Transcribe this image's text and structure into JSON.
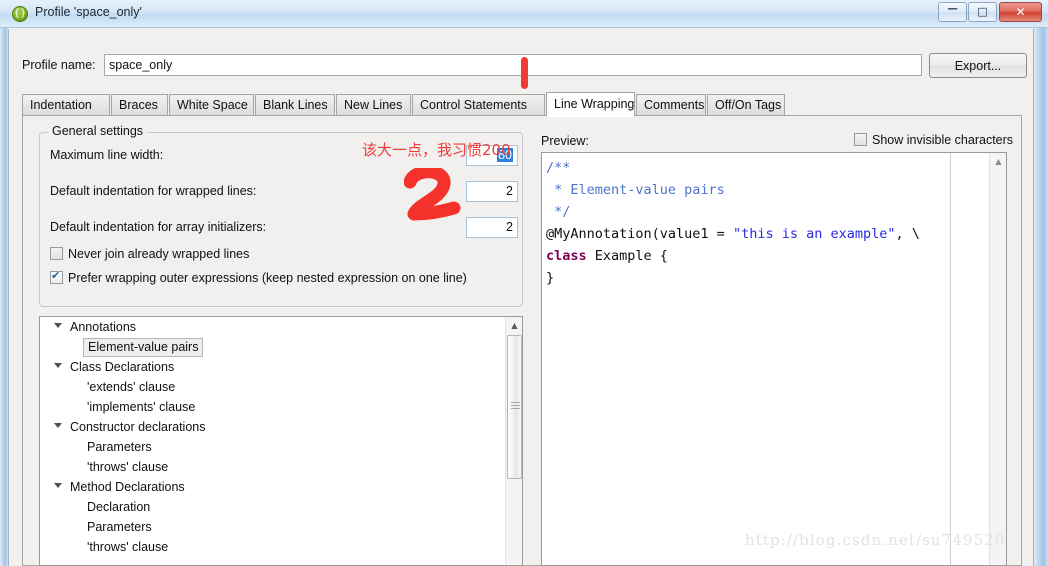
{
  "window": {
    "title": "Profile 'space_only'",
    "icon": "braces-icon",
    "minimize_label": "─",
    "maximize_label": "□",
    "close_label": "✕"
  },
  "profile": {
    "name_label": "Profile name:",
    "name_value": "space_only",
    "export_label": "Export..."
  },
  "tabs": [
    {
      "label": "Indentation",
      "selected": false
    },
    {
      "label": "Braces",
      "selected": false
    },
    {
      "label": "White Space",
      "selected": false
    },
    {
      "label": "Blank Lines",
      "selected": false
    },
    {
      "label": "New Lines",
      "selected": false
    },
    {
      "label": "Control Statements",
      "selected": false
    },
    {
      "label": "Line Wrapping",
      "selected": true
    },
    {
      "label": "Comments",
      "selected": false
    },
    {
      "label": "Off/On Tags",
      "selected": false
    }
  ],
  "general_settings": {
    "group_title": "General settings",
    "max_line_width_label": "Maximum line width:",
    "max_line_width_value": "80",
    "wrapped_indent_label": "Default indentation for wrapped lines:",
    "wrapped_indent_value": "2",
    "array_indent_label": "Default indentation for array initializers:",
    "array_indent_value": "2",
    "never_join_label": "Never join already wrapped lines",
    "never_join_checked": false,
    "prefer_wrapping_label": "Prefer wrapping outer expressions (keep nested expression on one line)",
    "prefer_wrapping_checked": true
  },
  "tree": {
    "items": [
      {
        "label": "Annotations",
        "level": 0,
        "expandable": true,
        "selected": false
      },
      {
        "label": "Element-value pairs",
        "level": 1,
        "expandable": false,
        "selected": true
      },
      {
        "label": "Class Declarations",
        "level": 0,
        "expandable": true,
        "selected": false
      },
      {
        "label": "'extends' clause",
        "level": 1,
        "expandable": false,
        "selected": false
      },
      {
        "label": "'implements' clause",
        "level": 1,
        "expandable": false,
        "selected": false
      },
      {
        "label": "Constructor declarations",
        "level": 0,
        "expandable": true,
        "selected": false
      },
      {
        "label": "Parameters",
        "level": 1,
        "expandable": false,
        "selected": false
      },
      {
        "label": "'throws' clause",
        "level": 1,
        "expandable": false,
        "selected": false
      },
      {
        "label": "Method Declarations",
        "level": 0,
        "expandable": true,
        "selected": false
      },
      {
        "label": "Declaration",
        "level": 1,
        "expandable": false,
        "selected": false
      },
      {
        "label": "Parameters",
        "level": 1,
        "expandable": false,
        "selected": false
      },
      {
        "label": "'throws' clause",
        "level": 1,
        "expandable": false,
        "selected": false
      }
    ]
  },
  "preview": {
    "label": "Preview:",
    "show_invisible_label": "Show invisible characters",
    "show_invisible_checked": false,
    "code_lines": [
      [
        {
          "t": "/**",
          "c": "comment"
        }
      ],
      [
        {
          "t": " * Element-value pairs",
          "c": "comment"
        }
      ],
      [
        {
          "t": " */",
          "c": "comment"
        }
      ],
      [
        {
          "t": "@MyAnnotation(value1 = ",
          "c": "plain"
        },
        {
          "t": "\"this is an example\"",
          "c": "string"
        },
        {
          "t": ", \\",
          "c": "plain"
        }
      ],
      [
        {
          "t": "class",
          "c": "keyword"
        },
        {
          "t": " Example {",
          "c": "plain"
        }
      ],
      [
        {
          "t": "}",
          "c": "plain"
        }
      ]
    ]
  },
  "annotations": {
    "chinese_note": "该大一点，我习惯200",
    "number_mark": "2",
    "tab_pointer": "red-vertical-bar",
    "color": "#ef3b36"
  },
  "watermark": "http://blog.csdn.net/su749520"
}
